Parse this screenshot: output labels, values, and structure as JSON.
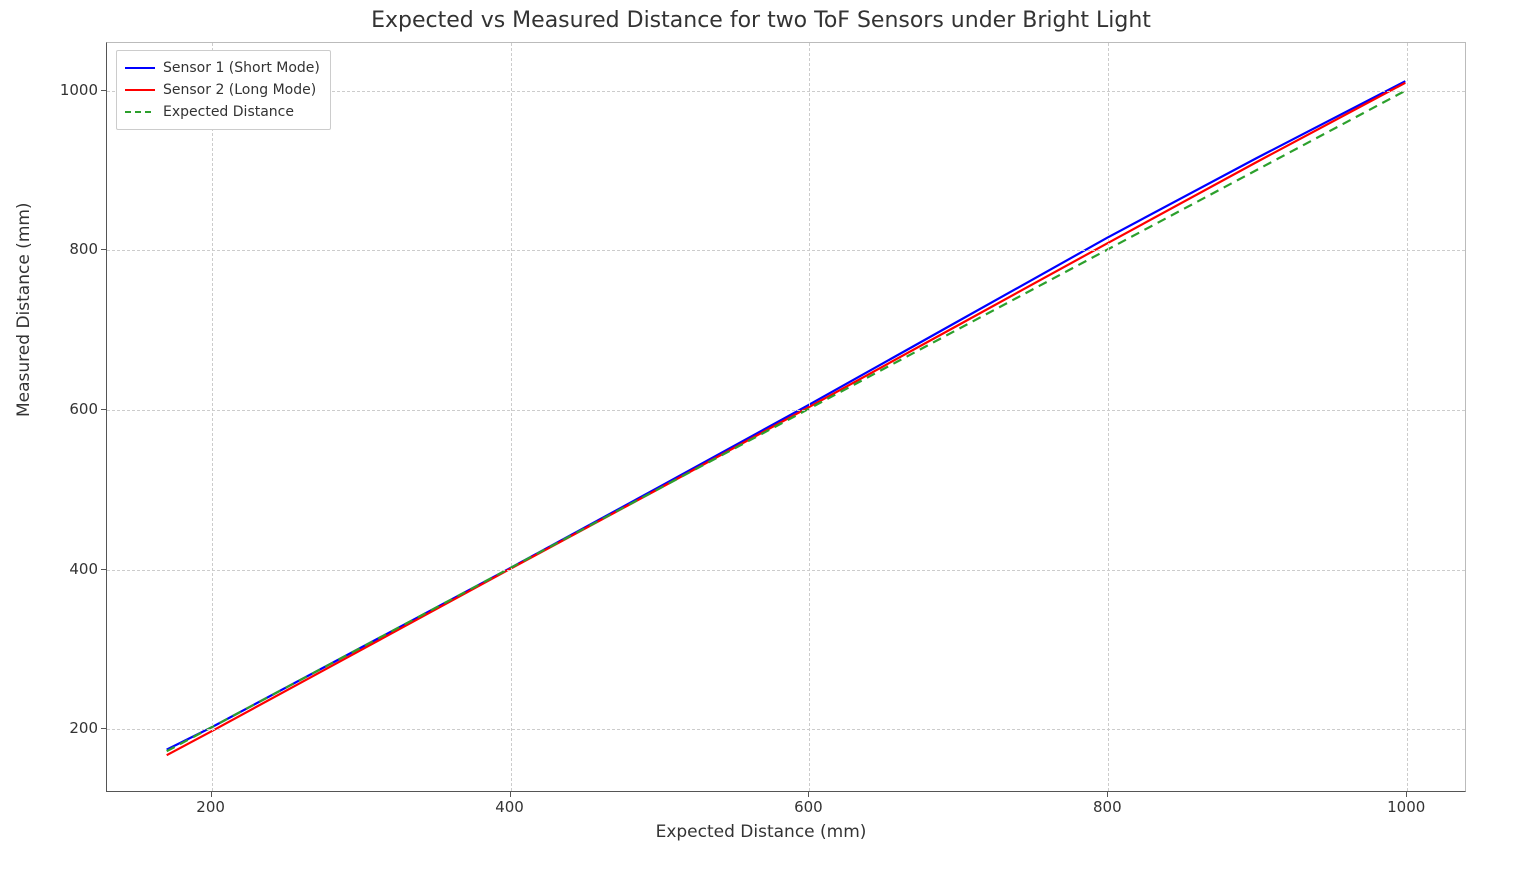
{
  "chart_data": {
    "type": "line",
    "title": "Expected vs Measured Distance for two ToF Sensors under Bright Light",
    "xlabel": "Expected Distance (mm)",
    "ylabel": "Measured Distance (mm)",
    "xlim": [
      130,
      1040
    ],
    "ylim": [
      120,
      1060
    ],
    "xticks": [
      200,
      400,
      600,
      800,
      1000
    ],
    "yticks": [
      200,
      400,
      600,
      800,
      1000
    ],
    "series": [
      {
        "name": "Sensor 1 (Short Mode)",
        "color": "#0000ff",
        "style": "solid",
        "x": [
          170,
          200,
          300,
          400,
          500,
          600,
          700,
          800,
          900,
          1000
        ],
        "y": [
          172,
          200,
          300,
          400,
          502,
          605,
          710,
          815,
          915,
          1012
        ]
      },
      {
        "name": "Sensor 2 (Long Mode)",
        "color": "#ff0000",
        "style": "solid",
        "x": [
          170,
          200,
          300,
          400,
          500,
          600,
          700,
          800,
          900,
          1000
        ],
        "y": [
          165,
          195,
          297,
          399,
          500,
          602,
          705,
          808,
          910,
          1010
        ]
      },
      {
        "name": "Expected Distance",
        "color": "#2ca02c",
        "style": "dashed",
        "x": [
          170,
          1000
        ],
        "y": [
          170,
          1000
        ]
      }
    ]
  },
  "legend": {
    "items": [
      "Sensor 1 (Short Mode)",
      "Sensor 2 (Long Mode)",
      "Expected Distance"
    ]
  }
}
